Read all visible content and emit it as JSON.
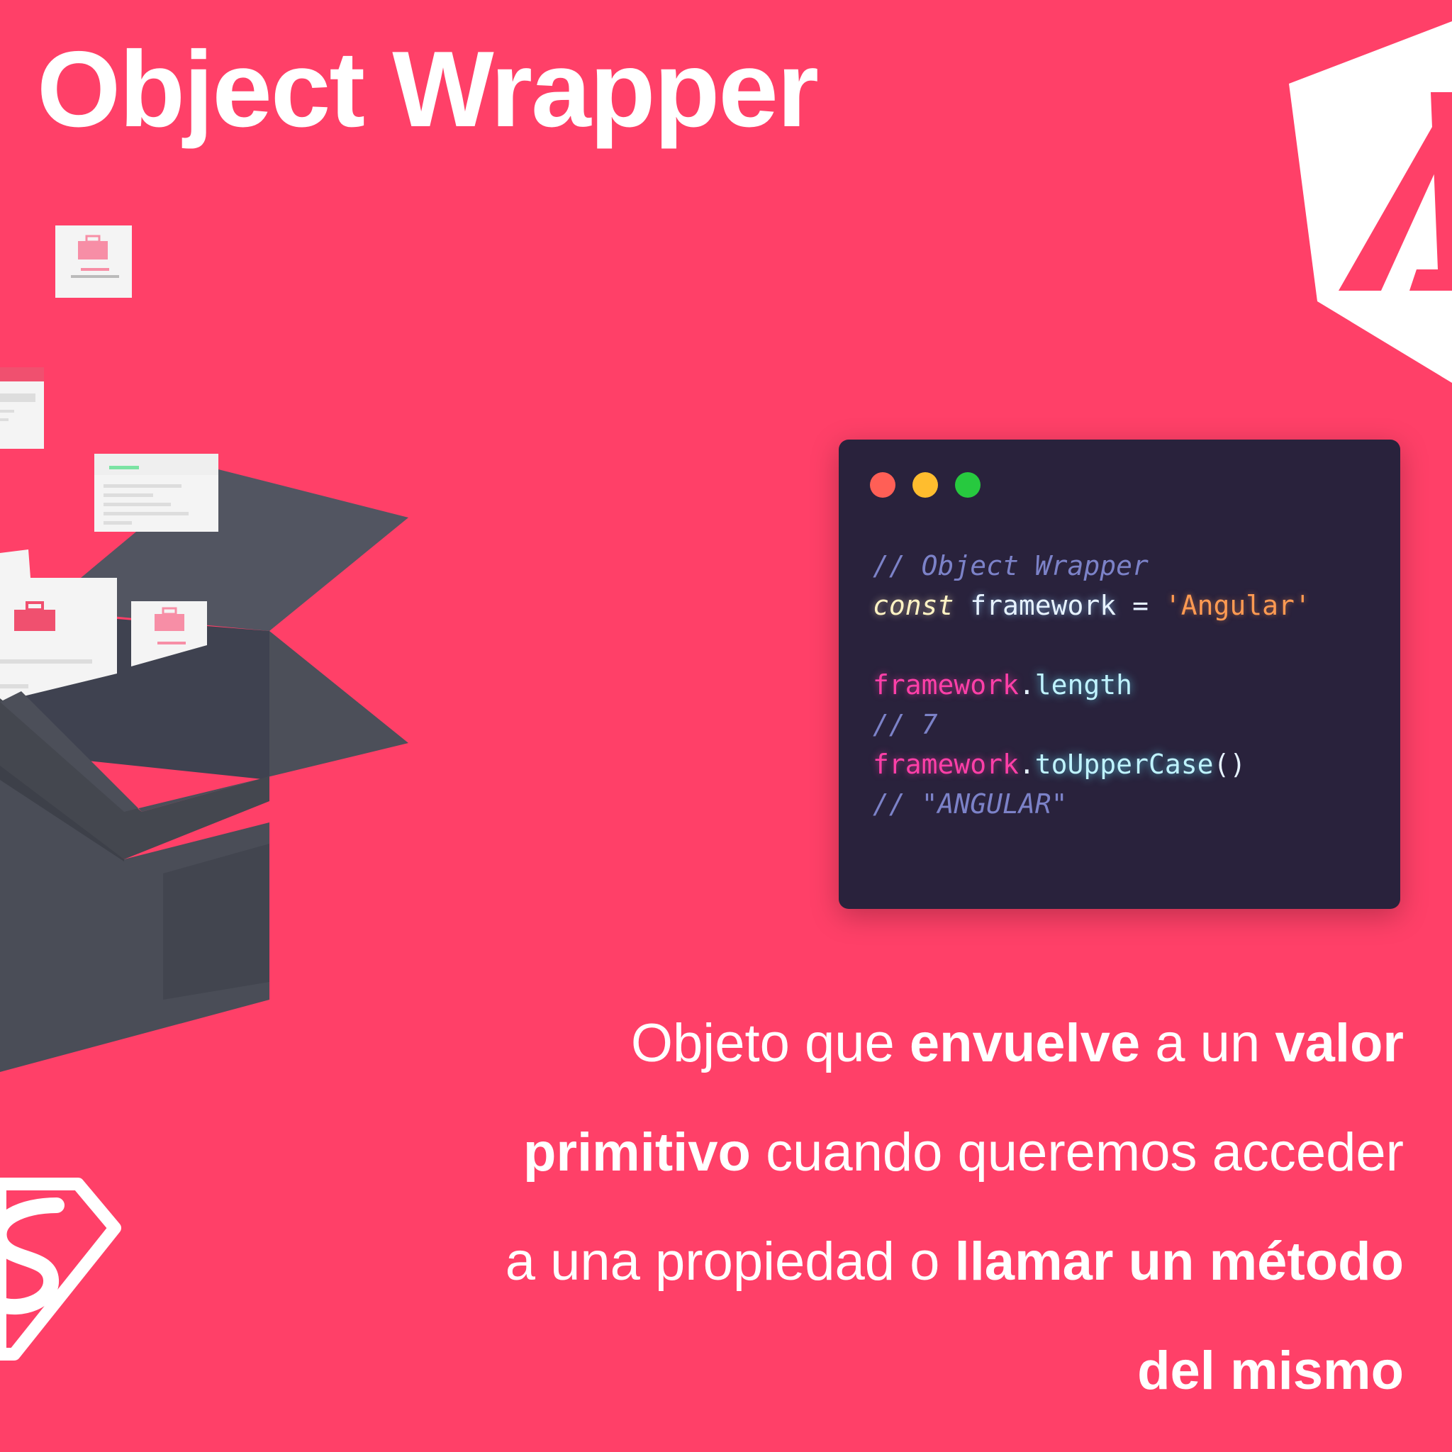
{
  "title": "Object Wrapper",
  "colors": {
    "background": "#FF4068",
    "code_background": "#29223C",
    "dot_red": "#FF5F56",
    "dot_yellow": "#FFBD2E",
    "dot_green": "#27C93F"
  },
  "icons": {
    "angular_logo": "angular-shield-logo",
    "brand_logo": "superman-style-shield-logo",
    "illustration": "open-box-with-documents"
  },
  "code": {
    "line1_comment": "// Object Wrapper",
    "line2_keyword": "const",
    "line2_name": "framework",
    "line2_op": "=",
    "line2_string": "'Angular'",
    "line4_obj": "framework",
    "line4_dot": ".",
    "line4_prop": "length",
    "line5_comment": "// 7",
    "line6_obj": "framework",
    "line6_dot": ".",
    "line6_method": "toUpperCase",
    "line6_parens": "()",
    "line7_comment": "// \"ANGULAR\""
  },
  "description": {
    "l1_a": "Objeto que ",
    "l1_b": "envuelve",
    "l1_c": " a un ",
    "l1_d": "valor",
    "l2_a": "primitivo",
    "l2_b": " cuando queremos acceder",
    "l3_a": "a una propiedad o  ",
    "l3_b": "llamar un método",
    "l4_a": "del mismo"
  }
}
